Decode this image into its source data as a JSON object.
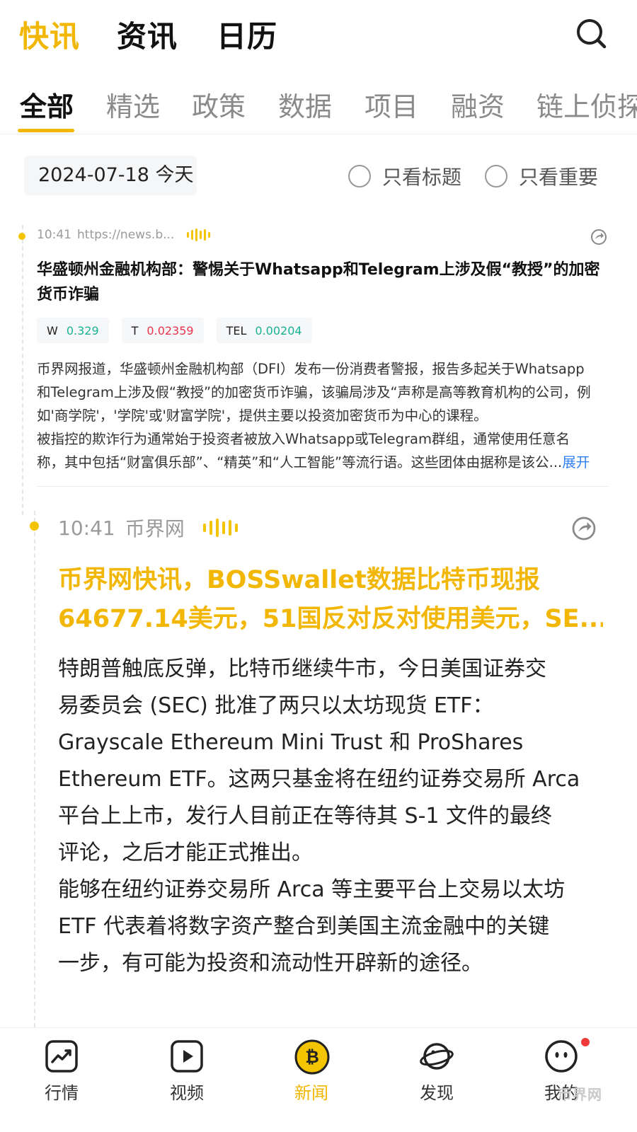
{
  "top_tabs": [
    "快讯",
    "资讯",
    "日历"
  ],
  "category_tabs": [
    "全部",
    "精选",
    "政策",
    "数据",
    "项目",
    "融资",
    "链上侦探"
  ],
  "date_label": "2024-07-18 今天",
  "filters": [
    "只看标题",
    "只看重要"
  ],
  "items": [
    {
      "time": "10:41",
      "source": "https://news.b...",
      "title": "华盛顿州金融机构部：警惕关于Whatsapp和Telegram上涉及假“教授”的加密货币诈骗",
      "title_lines": [
        "华盛顿州金融机构部：警惕关于Whatsapp和Telegram上涉及假“教授”的加密",
        "货币诈骗"
      ],
      "coins": [
        {
          "symbol": "W",
          "price": "0.329",
          "trend": "up"
        },
        {
          "symbol": "T",
          "price": "0.02359",
          "trend": "down"
        },
        {
          "symbol": "TEL",
          "price": "0.00204",
          "trend": "up"
        }
      ],
      "body_lines": [
        "币界网报道，华盛顿州金融机构部（DFI）发布一份消费者警报，报告多起关于Whatsapp",
        "和Telegram上涉及假“教授”的加密货币诈骗，该骗局涉及“声称是高等教育机构的公司，例",
        "如'商学院'，'学院'或'财富学院'，提供主要以投资加密货币为中心的课程。",
        "被指控的欺诈行为通常始于投资者被放入Whatsapp或Telegram群组，通常使用任意名",
        "称，其中包括“财富俱乐部”、“精英”和“人工智能”等流行语。这些团体由据称是该公..."
      ],
      "expand_label": "展开"
    },
    {
      "time": "10:41",
      "source": "币界网",
      "title_lines": [
        "币界网快讯，BOSSwallet数据比特币现报",
        "64677.14美元，51国反对反对使用美元，SE..."
      ],
      "body_lines": [
        "特朗普触底反弹，比特币继续牛市，今日美国证券交",
        "易委员会 (SEC) 批准了两只以太坊现货 ETF：",
        "Grayscale Ethereum Mini Trust 和 ProShares",
        "Ethereum ETF。这两只基金将在纽约证券交易所 Arca",
        "平台上上市，发行人目前正在等待其 S-1 文件的最终",
        "评论，之后才能正式推出。",
        "能够在纽约证券交易所 Arca 等主要平台上交易以太坊",
        "ETF 代表着将数字资产整合到美国主流金融中的关键",
        "一步，有可能为投资和流动性开辟新的途径。"
      ]
    }
  ],
  "bottom_nav": [
    {
      "label": "行情",
      "icon": "chart-icon"
    },
    {
      "label": "视频",
      "icon": "play-icon"
    },
    {
      "label": "新闻",
      "icon": "bitcoin-icon"
    },
    {
      "label": "发现",
      "icon": "planet-icon"
    },
    {
      "label": "我的",
      "icon": "face-icon"
    }
  ],
  "watermark": "币界网",
  "colors": {
    "accent": "#f2b705",
    "up": "#19b394",
    "down": "#e8354d",
    "link": "#2f7ff0"
  }
}
